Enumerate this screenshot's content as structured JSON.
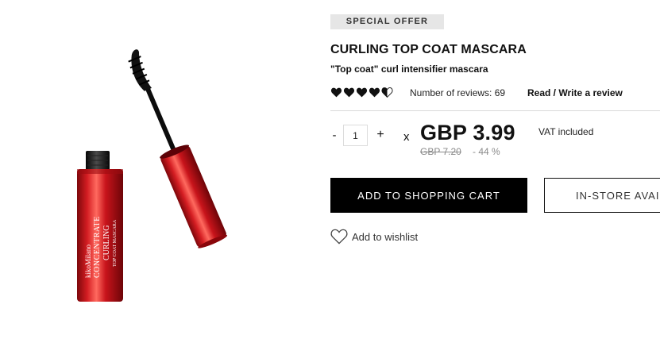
{
  "product": {
    "image_label": {
      "brand": "kikoMilano",
      "line": "CONCENTRATE",
      "name": "CURLING",
      "type": "TOP COAT MASCARA"
    },
    "badge": "SPECIAL OFFER",
    "title": "CURLING TOP COAT MASCARA",
    "subtitle": "\"Top coat\" curl intensifier mascara"
  },
  "rating": {
    "icon": "heart-icon",
    "value": 4.5,
    "max": 5,
    "reviews_label": "Number of reviews: 69",
    "review_link": "Read / Write a review"
  },
  "purchase": {
    "qty_minus": "-",
    "qty_value": "1",
    "qty_plus": "+",
    "times": "x",
    "price": "GBP 3.99",
    "old_price": "GBP 7.20",
    "discount": "- 44 %",
    "vat": "VAT included"
  },
  "actions": {
    "add_to_cart": "ADD TO SHOPPING CART",
    "in_store": "IN-STORE AVAI",
    "wishlist": "Add to wishlist"
  },
  "colors": {
    "accent": "#000000",
    "badge_bg": "#e6e6e6",
    "tube_red": "#c8141b",
    "muted_text": "#8a8a8a"
  }
}
